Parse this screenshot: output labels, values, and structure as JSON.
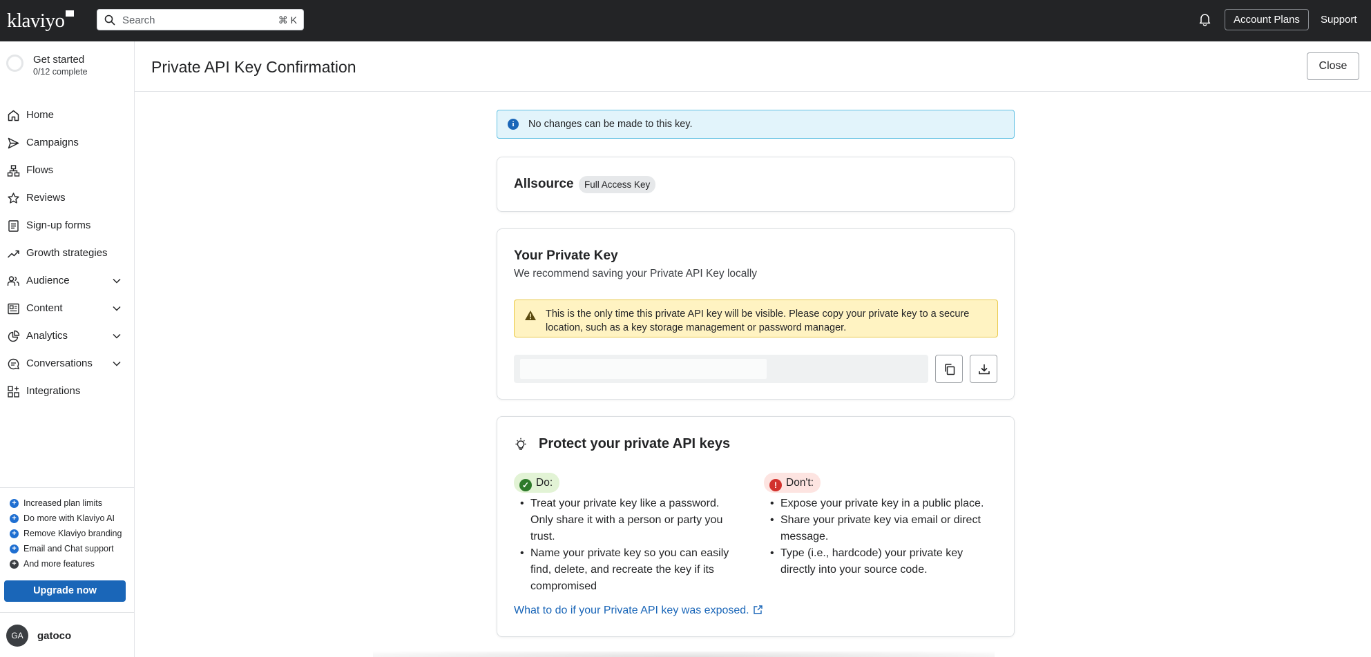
{
  "topbar": {
    "logo": "klaviyo",
    "search_placeholder": "Search",
    "search_shortcut": "⌘ K",
    "account_plans": "Account Plans",
    "support": "Support"
  },
  "sidebar": {
    "get_started": {
      "title": "Get started",
      "progress": "0/12 complete"
    },
    "items": [
      {
        "label": "Home",
        "icon": "home-icon",
        "expandable": false
      },
      {
        "label": "Campaigns",
        "icon": "send-icon",
        "expandable": false
      },
      {
        "label": "Flows",
        "icon": "flows-icon",
        "expandable": false
      },
      {
        "label": "Reviews",
        "icon": "star-icon",
        "expandable": false
      },
      {
        "label": "Sign-up forms",
        "icon": "form-icon",
        "expandable": false
      },
      {
        "label": "Growth strategies",
        "icon": "trend-icon",
        "expandable": false
      },
      {
        "label": "Audience",
        "icon": "audience-icon",
        "expandable": true
      },
      {
        "label": "Content",
        "icon": "content-icon",
        "expandable": true
      },
      {
        "label": "Analytics",
        "icon": "analytics-icon",
        "expandable": true
      },
      {
        "label": "Conversations",
        "icon": "chat-icon",
        "expandable": true
      },
      {
        "label": "Integrations",
        "icon": "integrations-icon",
        "expandable": false
      }
    ],
    "perks": [
      "Increased plan limits",
      "Do more with Klaviyo AI",
      "Remove Klaviyo branding",
      "Email and Chat support",
      "And more features"
    ],
    "upgrade_label": "Upgrade now",
    "user": {
      "initials": "GA",
      "name": "gatoco"
    }
  },
  "page": {
    "title": "Private API Key Confirmation",
    "close_label": "Close",
    "info_banner": "No changes can be made to this key."
  },
  "key_card": {
    "name": "Allsource",
    "badge": "Full Access Key"
  },
  "private_key_card": {
    "title": "Your Private Key",
    "subtitle": "We recommend saving your Private API Key locally",
    "warning": "This is the only time this private API key will be visible. Please copy your private key to a secure location, such as a key storage management or password manager."
  },
  "protect_card": {
    "title": "Protect your private API keys",
    "do_label": "Do:",
    "dont_label": "Don't:",
    "do_items": [
      "Treat your private key like a password. Only share it with a person or party you trust.",
      "Name your private key so you can easily find, delete, and recreate the key if its compromised"
    ],
    "dont_items": [
      "Expose your private key in a public place.",
      "Share your private key via email or direct message.",
      "Type (i.e., hardcode) your private key directly into your source code."
    ],
    "exposed_link": "What to do if your Private API key was exposed."
  },
  "colors": {
    "topbar": "#232426",
    "accent": "#1a66b8",
    "info_bg": "#e2f4fb",
    "warning_bg": "#fff3c2"
  }
}
